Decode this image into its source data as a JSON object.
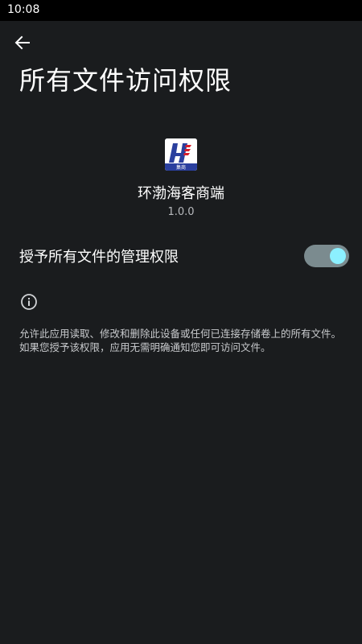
{
  "status_bar": {
    "time": "10:08"
  },
  "header": {
    "back_icon": "arrow-back-icon",
    "title": "所有文件访问权限"
  },
  "app": {
    "icon": "app-logo-icon",
    "icon_badge_text": "集商",
    "name": "环渤海客商端",
    "version": "1.0.0"
  },
  "setting": {
    "label": "授予所有文件的管理权限",
    "enabled": true
  },
  "info": {
    "icon": "info-icon",
    "description": "允许此应用读取、修改和删除此设备或任何已连接存储卷上的所有文件。如果您授予该权限，应用无需明确通知您即可访问文件。"
  },
  "colors": {
    "background": "#1a1c1e",
    "toggle_track": "#7b8b8f",
    "toggle_thumb": "#8cf0ff",
    "icon_blue": "#2a3f9e",
    "icon_red": "#d81e2c"
  }
}
